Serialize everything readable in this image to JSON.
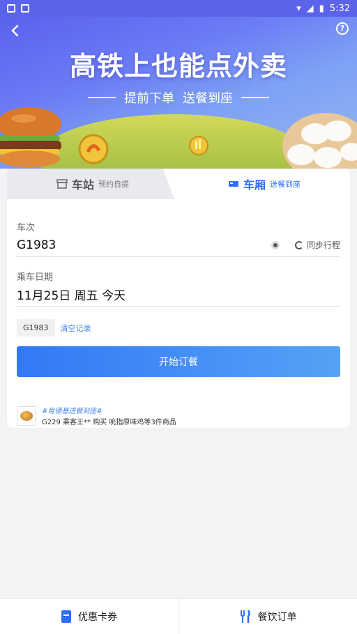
{
  "status_bar": {
    "time": "5:32"
  },
  "banner": {
    "title": "高铁上也能点外卖",
    "subtitle_left": "提前下单",
    "subtitle_right": "送餐到座"
  },
  "tabs": [
    {
      "label": "车站",
      "sub": "预约自提",
      "active": false,
      "icon": "store-icon"
    },
    {
      "label": "车厢",
      "sub": "送餐到座",
      "active": true,
      "icon": "coach-icon"
    }
  ],
  "form": {
    "train_label": "车次",
    "train_value": "G1983",
    "sync_label": "同步行程",
    "date_label": "乘车日期",
    "date_value": "11月25日 周五 今天"
  },
  "history": {
    "chip": "G1983",
    "clear": "清空记录"
  },
  "order_button": "开始订餐",
  "promo": {
    "tag": "#肯德基送餐到座#",
    "text": "G229 乘客王** 购买 吮指原味鸡等3件商品"
  },
  "bottom_nav": [
    {
      "label": "优惠卡券",
      "icon": "coupon-icon"
    },
    {
      "label": "餐饮订单",
      "icon": "fork-knife-icon"
    }
  ],
  "colors": {
    "accent": "#2f6ef5",
    "banner": "#5b61ee"
  }
}
